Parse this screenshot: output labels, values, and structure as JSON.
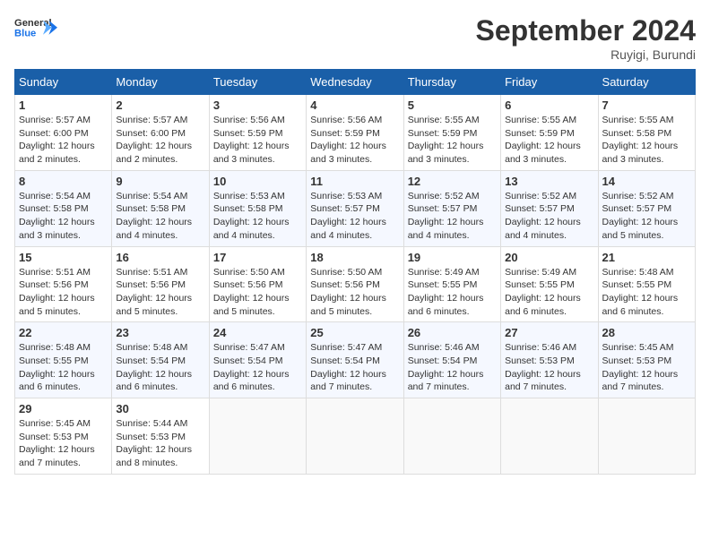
{
  "header": {
    "logo_line1": "General",
    "logo_line2": "Blue",
    "month_title": "September 2024",
    "location": "Ruyigi, Burundi"
  },
  "weekdays": [
    "Sunday",
    "Monday",
    "Tuesday",
    "Wednesday",
    "Thursday",
    "Friday",
    "Saturday"
  ],
  "weeks": [
    [
      {
        "day": "1",
        "sunrise": "5:57 AM",
        "sunset": "6:00 PM",
        "daylight": "12 hours and 2 minutes."
      },
      {
        "day": "2",
        "sunrise": "5:57 AM",
        "sunset": "6:00 PM",
        "daylight": "12 hours and 2 minutes."
      },
      {
        "day": "3",
        "sunrise": "5:56 AM",
        "sunset": "5:59 PM",
        "daylight": "12 hours and 3 minutes."
      },
      {
        "day": "4",
        "sunrise": "5:56 AM",
        "sunset": "5:59 PM",
        "daylight": "12 hours and 3 minutes."
      },
      {
        "day": "5",
        "sunrise": "5:55 AM",
        "sunset": "5:59 PM",
        "daylight": "12 hours and 3 minutes."
      },
      {
        "day": "6",
        "sunrise": "5:55 AM",
        "sunset": "5:59 PM",
        "daylight": "12 hours and 3 minutes."
      },
      {
        "day": "7",
        "sunrise": "5:55 AM",
        "sunset": "5:58 PM",
        "daylight": "12 hours and 3 minutes."
      }
    ],
    [
      {
        "day": "8",
        "sunrise": "5:54 AM",
        "sunset": "5:58 PM",
        "daylight": "12 hours and 3 minutes."
      },
      {
        "day": "9",
        "sunrise": "5:54 AM",
        "sunset": "5:58 PM",
        "daylight": "12 hours and 4 minutes."
      },
      {
        "day": "10",
        "sunrise": "5:53 AM",
        "sunset": "5:58 PM",
        "daylight": "12 hours and 4 minutes."
      },
      {
        "day": "11",
        "sunrise": "5:53 AM",
        "sunset": "5:57 PM",
        "daylight": "12 hours and 4 minutes."
      },
      {
        "day": "12",
        "sunrise": "5:52 AM",
        "sunset": "5:57 PM",
        "daylight": "12 hours and 4 minutes."
      },
      {
        "day": "13",
        "sunrise": "5:52 AM",
        "sunset": "5:57 PM",
        "daylight": "12 hours and 4 minutes."
      },
      {
        "day": "14",
        "sunrise": "5:52 AM",
        "sunset": "5:57 PM",
        "daylight": "12 hours and 5 minutes."
      }
    ],
    [
      {
        "day": "15",
        "sunrise": "5:51 AM",
        "sunset": "5:56 PM",
        "daylight": "12 hours and 5 minutes."
      },
      {
        "day": "16",
        "sunrise": "5:51 AM",
        "sunset": "5:56 PM",
        "daylight": "12 hours and 5 minutes."
      },
      {
        "day": "17",
        "sunrise": "5:50 AM",
        "sunset": "5:56 PM",
        "daylight": "12 hours and 5 minutes."
      },
      {
        "day": "18",
        "sunrise": "5:50 AM",
        "sunset": "5:56 PM",
        "daylight": "12 hours and 5 minutes."
      },
      {
        "day": "19",
        "sunrise": "5:49 AM",
        "sunset": "5:55 PM",
        "daylight": "12 hours and 6 minutes."
      },
      {
        "day": "20",
        "sunrise": "5:49 AM",
        "sunset": "5:55 PM",
        "daylight": "12 hours and 6 minutes."
      },
      {
        "day": "21",
        "sunrise": "5:48 AM",
        "sunset": "5:55 PM",
        "daylight": "12 hours and 6 minutes."
      }
    ],
    [
      {
        "day": "22",
        "sunrise": "5:48 AM",
        "sunset": "5:55 PM",
        "daylight": "12 hours and 6 minutes."
      },
      {
        "day": "23",
        "sunrise": "5:48 AM",
        "sunset": "5:54 PM",
        "daylight": "12 hours and 6 minutes."
      },
      {
        "day": "24",
        "sunrise": "5:47 AM",
        "sunset": "5:54 PM",
        "daylight": "12 hours and 6 minutes."
      },
      {
        "day": "25",
        "sunrise": "5:47 AM",
        "sunset": "5:54 PM",
        "daylight": "12 hours and 7 minutes."
      },
      {
        "day": "26",
        "sunrise": "5:46 AM",
        "sunset": "5:54 PM",
        "daylight": "12 hours and 7 minutes."
      },
      {
        "day": "27",
        "sunrise": "5:46 AM",
        "sunset": "5:53 PM",
        "daylight": "12 hours and 7 minutes."
      },
      {
        "day": "28",
        "sunrise": "5:45 AM",
        "sunset": "5:53 PM",
        "daylight": "12 hours and 7 minutes."
      }
    ],
    [
      {
        "day": "29",
        "sunrise": "5:45 AM",
        "sunset": "5:53 PM",
        "daylight": "12 hours and 7 minutes."
      },
      {
        "day": "30",
        "sunrise": "5:44 AM",
        "sunset": "5:53 PM",
        "daylight": "12 hours and 8 minutes."
      },
      null,
      null,
      null,
      null,
      null
    ]
  ]
}
